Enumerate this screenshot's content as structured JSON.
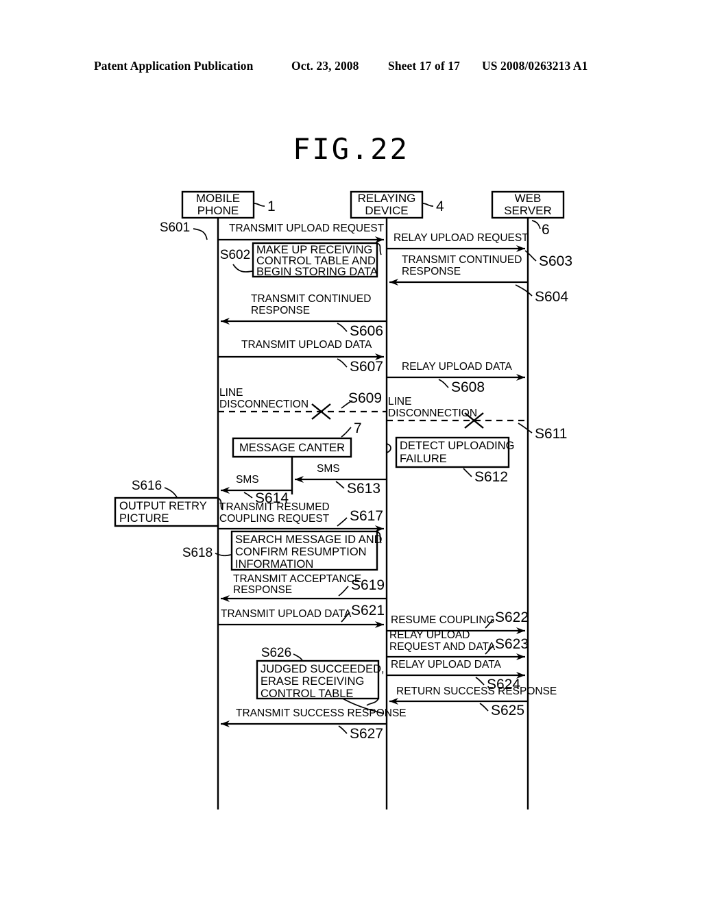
{
  "header": {
    "publication": "Patent Application Publication",
    "date": "Oct. 23, 2008",
    "sheet": "Sheet 17 of 17",
    "patent_number": "US 2008/0263213 A1"
  },
  "figure": {
    "title": "FIG.22"
  },
  "actors": [
    {
      "id": "mobile",
      "label_line1": "MOBILE",
      "label_line2": "PHONE",
      "ref": "1"
    },
    {
      "id": "relay",
      "label_line1": "RELAYING",
      "label_line2": "DEVICE",
      "ref": "4"
    },
    {
      "id": "server",
      "label_line1": "WEB",
      "label_line2": "SERVER",
      "ref": "6"
    }
  ],
  "message_center": {
    "label": "MESSAGE CANTER",
    "ref": "7"
  },
  "messages": [
    {
      "step": "S601",
      "label": "TRANSMIT UPLOAD REQUEST",
      "from": "mobile",
      "to": "relay",
      "kind": "solid"
    },
    {
      "step": "S603",
      "label": "RELAY UPLOAD REQUEST",
      "from": "relay",
      "to": "server",
      "kind": "solid"
    },
    {
      "step": "S604",
      "label_line1": "TRANSMIT CONTINUED",
      "label_line2": "RESPONSE",
      "from": "server",
      "to": "relay",
      "kind": "solid"
    },
    {
      "step": "S606",
      "label_line1": "TRANSMIT CONTINUED",
      "label_line2": "RESPONSE",
      "from": "relay",
      "to": "mobile",
      "kind": "solid"
    },
    {
      "step": "S607",
      "label": "TRANSMIT UPLOAD DATA",
      "from": "mobile",
      "to": "relay",
      "kind": "solid"
    },
    {
      "step": "S608",
      "label": "RELAY UPLOAD DATA",
      "from": "relay",
      "to": "server",
      "kind": "solid"
    },
    {
      "step": "S609",
      "label_line1": "LINE",
      "label_line2": "DISCONNECTION",
      "from": "mobile",
      "to": "relay",
      "kind": "broken"
    },
    {
      "step": "S611",
      "label_line1": "LINE",
      "label_line2": "DISCONNECTION",
      "from": "relay",
      "to": "server",
      "kind": "broken"
    },
    {
      "step": "S613",
      "label": "SMS",
      "from": "relay",
      "to": "center",
      "kind": "solid"
    },
    {
      "step": "S614",
      "label": "SMS",
      "from": "center",
      "to": "mobile",
      "kind": "solid"
    },
    {
      "step": "S617",
      "label_line1": "TRANSMIT RESUMED",
      "label_line2": "COUPLING REQUEST",
      "from": "mobile",
      "to": "relay",
      "kind": "solid"
    },
    {
      "step": "S619",
      "label_line1": "TRANSMIT ACCEPTANCE",
      "label_line2": "RESPONSE",
      "from": "relay",
      "to": "mobile",
      "kind": "solid"
    },
    {
      "step": "S621",
      "label": "TRANSMIT UPLOAD DATA",
      "from": "mobile",
      "to": "relay",
      "kind": "solid"
    },
    {
      "step": "S622",
      "label": "RESUME COUPLING",
      "from": "relay",
      "to": "server",
      "kind": "solid"
    },
    {
      "step": "S623",
      "label_line1": "RELAY UPLOAD",
      "label_line2": "REQUEST AND DATA",
      "from": "relay",
      "to": "server",
      "kind": "solid"
    },
    {
      "step": "S624",
      "label": "RELAY UPLOAD DATA",
      "from": "relay",
      "to": "server",
      "kind": "solid"
    },
    {
      "step": "S625",
      "label": "RETURN SUCCESS RESPONSE",
      "from": "server",
      "to": "relay",
      "kind": "solid"
    },
    {
      "step": "S627",
      "label": "TRANSMIT SUCCESS RESPONSE",
      "from": "relay",
      "to": "mobile",
      "kind": "solid"
    }
  ],
  "action_boxes": [
    {
      "step": "S602",
      "lines": [
        "MAKE UP RECEIVING",
        "CONTROL TABLE AND",
        "BEGIN STORING DATA"
      ],
      "actor": "relay"
    },
    {
      "step": "S612",
      "lines": [
        "DETECT UPLOADING",
        "FAILURE"
      ],
      "actor": "relay"
    },
    {
      "step": "S616",
      "lines": [
        "OUTPUT RETRY",
        "PICTURE"
      ],
      "actor": "mobile"
    },
    {
      "step": "S618",
      "lines": [
        "SEARCH  MESSAGE ID AND",
        "CONFIRM RESUMPTION",
        "INFORMATION"
      ],
      "actor": "relay"
    },
    {
      "step": "S626",
      "lines": [
        "JUDGED SUCCEEDED,",
        "ERASE RECEIVING",
        "CONTROL TABLE"
      ],
      "actor": "relay"
    }
  ]
}
